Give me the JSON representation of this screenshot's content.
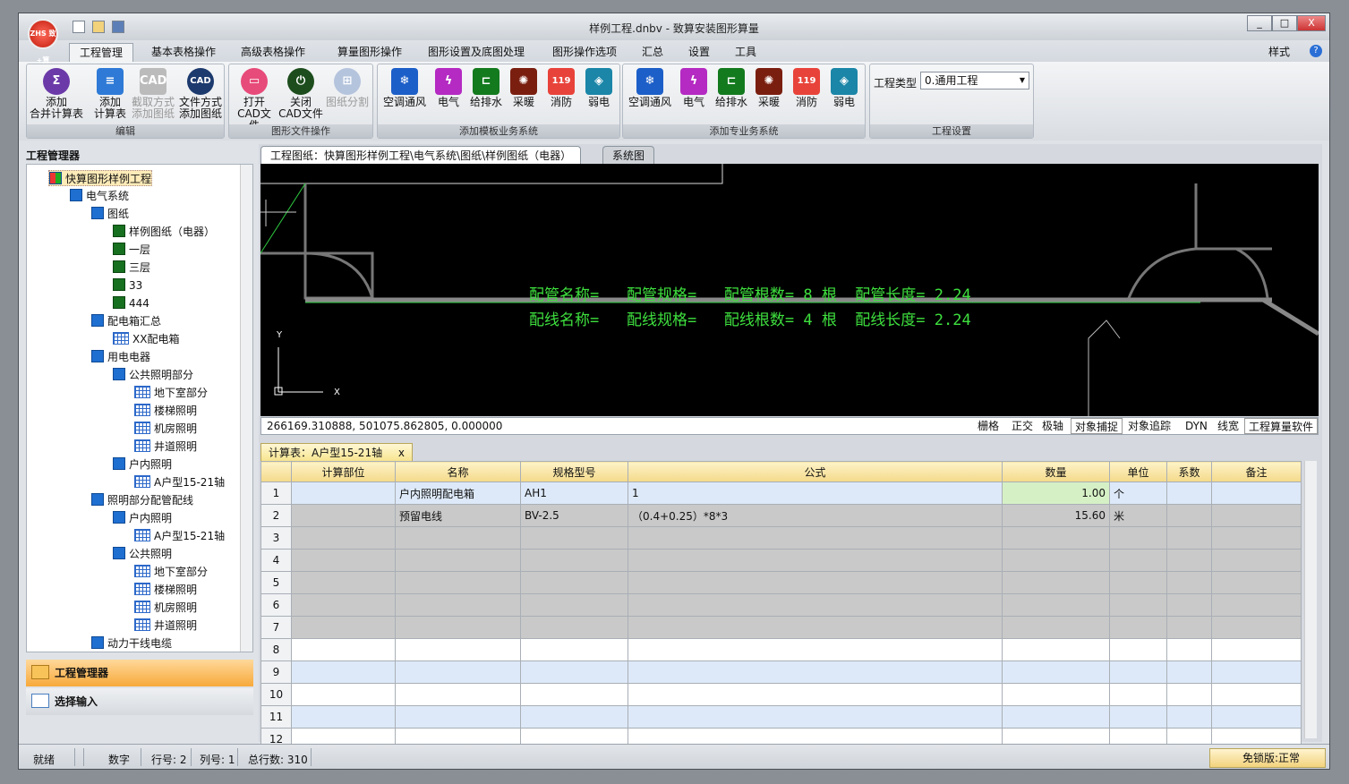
{
  "window": {
    "title": "样例工程.dnbv - 致算安装图形算量",
    "logo": "ZHS 致+算",
    "min_label": "_",
    "max_label": "□",
    "close_label": "X"
  },
  "menu": {
    "tabs": [
      "工程管理",
      "基本表格操作",
      "高级表格操作",
      "算量图形操作",
      "图形设置及底图处理",
      "图形操作选项",
      "汇总",
      "设置",
      "工具"
    ],
    "style_label": "样式",
    "help_icon": "?"
  },
  "ribbon": {
    "edit": {
      "caption": "编辑",
      "btns": [
        {
          "l1": "添加",
          "l2": "合并计算表"
        },
        {
          "l1": "添加",
          "l2": "计算表"
        },
        {
          "l1": "截取方式",
          "l2": "添加图纸"
        },
        {
          "l1": "文件方式",
          "l2": "添加图纸"
        }
      ],
      "cad_icon": "CAD"
    },
    "file": {
      "caption": "图形文件操作",
      "btns": [
        {
          "l1": "打开",
          "l2": "CAD文件"
        },
        {
          "l1": "关闭",
          "l2": "CAD文件"
        },
        {
          "l1": "图纸分割",
          "l2": ""
        }
      ]
    },
    "tpl": {
      "caption": "添加模板业务系统",
      "btns": [
        "空调通风",
        "电气",
        "给排水",
        "采暖",
        "消防",
        "弱电"
      ]
    },
    "pro": {
      "caption": "添加专业务系统",
      "btns": [
        "空调通风",
        "电气",
        "给排水",
        "采暖",
        "消防",
        "弱电"
      ]
    },
    "proj": {
      "caption": "工程设置",
      "type_label": "工程类型",
      "type_value": "0.通用工程"
    }
  },
  "tree": {
    "header": "工程管理器",
    "nodes": [
      "快算图形样例工程",
      "电气系统",
      "图纸",
      "样例图纸（电器）",
      "一层",
      "三层",
      "33",
      "444",
      "配电箱汇总",
      "XX配电箱",
      "用电电器",
      "公共照明部分",
      "地下室部分",
      "楼梯照明",
      "机房照明",
      "井道照明",
      "户内照明",
      "A户型15-21轴",
      "照明部分配管配线",
      "户内照明",
      "A户型15-21轴",
      "公共照明",
      "地下室部分",
      "楼梯照明",
      "机房照明",
      "井道照明",
      "动力干线电缆"
    ]
  },
  "left_buttons": [
    "工程管理器",
    "选择输入"
  ],
  "doc": {
    "tab": "工程图纸：快算图形样例工程\\电气系统\\图纸\\样例图纸（电器）",
    "tab2": "系统图"
  },
  "cad": {
    "line1": "配管名称=   配管规格=   配管根数= 8 根  配管长度= 2.24",
    "line2": "配线名称=   配线规格=   配线根数= 4 根  配线长度= 2.24",
    "axis_y": "Y",
    "axis_x": "X",
    "coords": "266169.310888, 501075.862805, 0.000000",
    "status": [
      "栅格",
      "正交",
      "极轴",
      "对象捕捉",
      "对象追踪",
      "DYN",
      "线宽",
      "工程算量软件"
    ]
  },
  "grid": {
    "tab": "计算表：A户型15-21轴",
    "tab_close": "x",
    "headers": [
      "",
      "计算部位",
      "名称",
      "规格型号",
      "公式",
      "数量",
      "单位",
      "系数",
      "备注"
    ],
    "rows": [
      [
        "1",
        "",
        "户内照明配电箱",
        "AH1",
        "1",
        "1.00",
        "个",
        "",
        ""
      ],
      [
        "2",
        "",
        "预留电线",
        "BV-2.5",
        "（0.4+0.25）*8*3",
        "15.60",
        "米",
        "",
        ""
      ],
      [
        "3",
        "",
        "",
        "",
        "",
        "",
        "",
        "",
        ""
      ],
      [
        "4",
        "",
        "",
        "",
        "",
        "",
        "",
        "",
        ""
      ],
      [
        "5",
        "",
        "",
        "",
        "",
        "",
        "",
        "",
        ""
      ],
      [
        "6",
        "",
        "",
        "",
        "",
        "",
        "",
        "",
        ""
      ],
      [
        "7",
        "",
        "",
        "",
        "",
        "",
        "",
        "",
        ""
      ],
      [
        "8",
        "",
        "",
        "",
        "",
        "",
        "",
        "",
        ""
      ],
      [
        "9",
        "",
        "",
        "",
        "",
        "",
        "",
        "",
        ""
      ],
      [
        "10",
        "",
        "",
        "",
        "",
        "",
        "",
        "",
        ""
      ],
      [
        "11",
        "",
        "",
        "",
        "",
        "",
        "",
        "",
        ""
      ],
      [
        "12",
        "",
        "",
        "",
        "",
        "",
        "",
        "",
        ""
      ]
    ]
  },
  "status": {
    "ready": "就绪",
    "num": "数字",
    "row": "行号: 2",
    "col": "列号: 1",
    "total": "总行数: 310",
    "version": "免锁版:正常"
  }
}
